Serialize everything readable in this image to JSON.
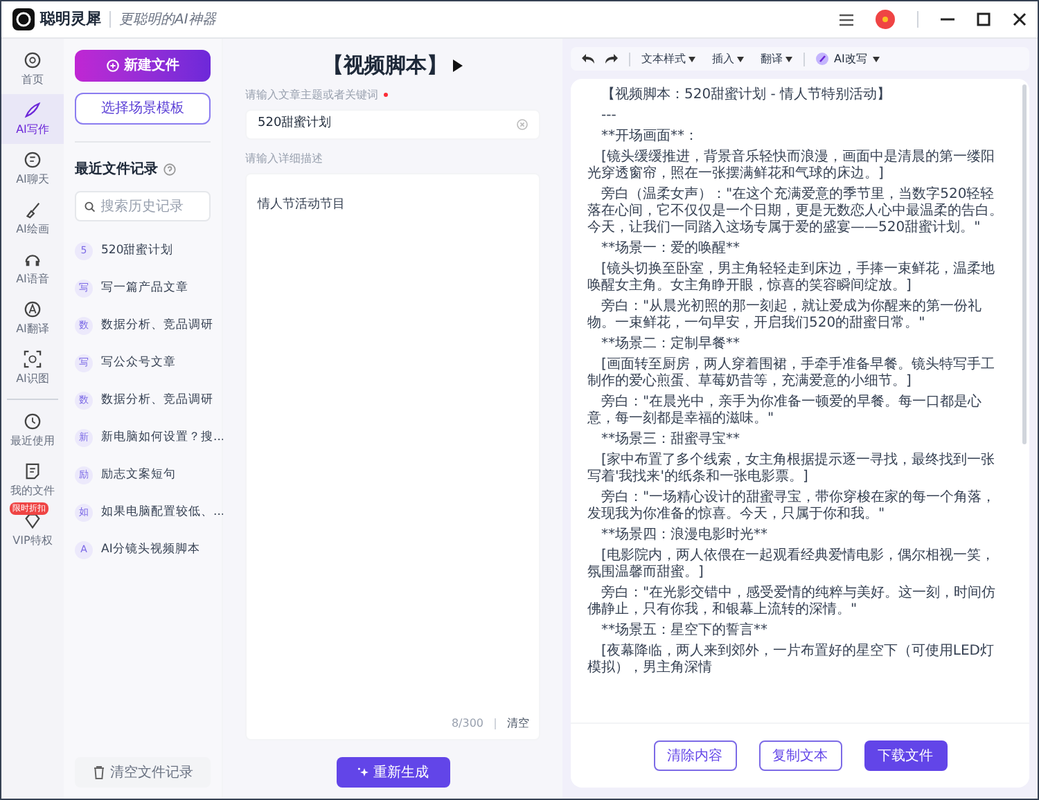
{
  "app": {
    "name": "聪明灵犀",
    "slogan": "更聪明的AI神器"
  },
  "nav": [
    {
      "label": "首页",
      "selected": false
    },
    {
      "label": "AI写作",
      "selected": true
    },
    {
      "label": "AI聊天",
      "selected": false
    },
    {
      "label": "AI绘画",
      "selected": false
    },
    {
      "label": "AI语音",
      "selected": false
    },
    {
      "label": "AI翻译",
      "selected": false
    },
    {
      "label": "AI识图",
      "selected": false
    }
  ],
  "nav_bottom": [
    {
      "label": "最近使用"
    },
    {
      "label": "我的文件"
    },
    {
      "label": "VIP特权",
      "badge": "限时折扣"
    }
  ],
  "files_panel": {
    "new_button": "新建文件",
    "template_button": "选择场景模板",
    "recent_title": "最近文件记录",
    "search_placeholder": "搜索历史记录",
    "clear_button": "清空文件记录",
    "items": [
      {
        "avatar": "5",
        "title": "520甜蜜计划"
      },
      {
        "avatar": "写",
        "title": "写一篇产品文章"
      },
      {
        "avatar": "数",
        "title": "数据分析、竞品调研"
      },
      {
        "avatar": "写",
        "title": "写公众号文章"
      },
      {
        "avatar": "数",
        "title": "数据分析、竞品调研"
      },
      {
        "avatar": "新",
        "title": "新电脑如何设置？搜..."
      },
      {
        "avatar": "励",
        "title": "励志文案短句"
      },
      {
        "avatar": "如",
        "title": "如果电脑配置较低、..."
      },
      {
        "avatar": "A",
        "title": "AI分镜头视频脚本"
      }
    ]
  },
  "form": {
    "title": "【视频脚本】",
    "topic_label": "请输入文章主题或者关键词",
    "topic_value": "520甜蜜计划",
    "detail_label": "请输入详细描述",
    "detail_value": "情人节活动节目",
    "counter": "8/300",
    "clear": "清空",
    "regenerate_button": "重新生成"
  },
  "toolbar": {
    "menus": [
      "文本样式",
      "插入",
      "翻译"
    ],
    "ai_menu": "AI改写"
  },
  "document": {
    "paragraphs": [
      "【视频脚本：520甜蜜计划 - 情人节特别活动】",
      "---",
      "**开场画面**：",
      "[镜头缓缓推进，背景音乐轻快而浪漫，画面中是清晨的第一缕阳光穿透窗帘，照在一张摆满鲜花和气球的床边。]",
      "旁白（温柔女声）：\"在这个充满爱意的季节里，当数字520轻轻落在心间，它不仅仅是一个日期，更是无数恋人心中最温柔的告白。今天，让我们一同踏入这场专属于爱的盛宴——520甜蜜计划。\"",
      "**场景一：爱的唤醒**",
      "[镜头切换至卧室，男主角轻轻走到床边，手捧一束鲜花，温柔地唤醒女主角。女主角睁开眼，惊喜的笑容瞬间绽放。]",
      "旁白：\"从晨光初照的那一刻起，就让爱成为你醒来的第一份礼物。一束鲜花，一句早安，开启我们520的甜蜜日常。\"",
      "**场景二：定制早餐**",
      "[画面转至厨房，两人穿着围裙，手牵手准备早餐。镜头特写手工制作的爱心煎蛋、草莓奶昔等，充满爱意的小细节。]",
      "旁白：\"在晨光中，亲手为你准备一顿爱的早餐。每一口都是心意，每一刻都是幸福的滋味。\"",
      "**场景三：甜蜜寻宝**",
      "[家中布置了多个线索，女主角根据提示逐一寻找，最终找到一张写着'我找来'的纸条和一张电影票。]",
      "旁白：\"一场精心设计的甜蜜寻宝，带你穿梭在家的每一个角落，发现我为你准备的惊喜。今天，只属于你和我。\"",
      "**场景四：浪漫电影时光**",
      "[电影院内，两人依偎在一起观看经典爱情电影，偶尔相视一笑，氛围温馨而甜蜜。]",
      "旁白：\"在光影交错中，感受爱情的纯粹与美好。这一刻，时间仿佛静止，只有你我，和银幕上流转的深情。\"",
      "**场景五：星空下的誓言**",
      "[夜幕降临，两人来到郊外，一片布置好的星空下（可使用LED灯模拟），男主角深情"
    ]
  },
  "actions": [
    {
      "label": "清除内容",
      "kind": "outline"
    },
    {
      "label": "复制文本",
      "kind": "outline"
    },
    {
      "label": "下载文件",
      "kind": "primary"
    }
  ]
}
